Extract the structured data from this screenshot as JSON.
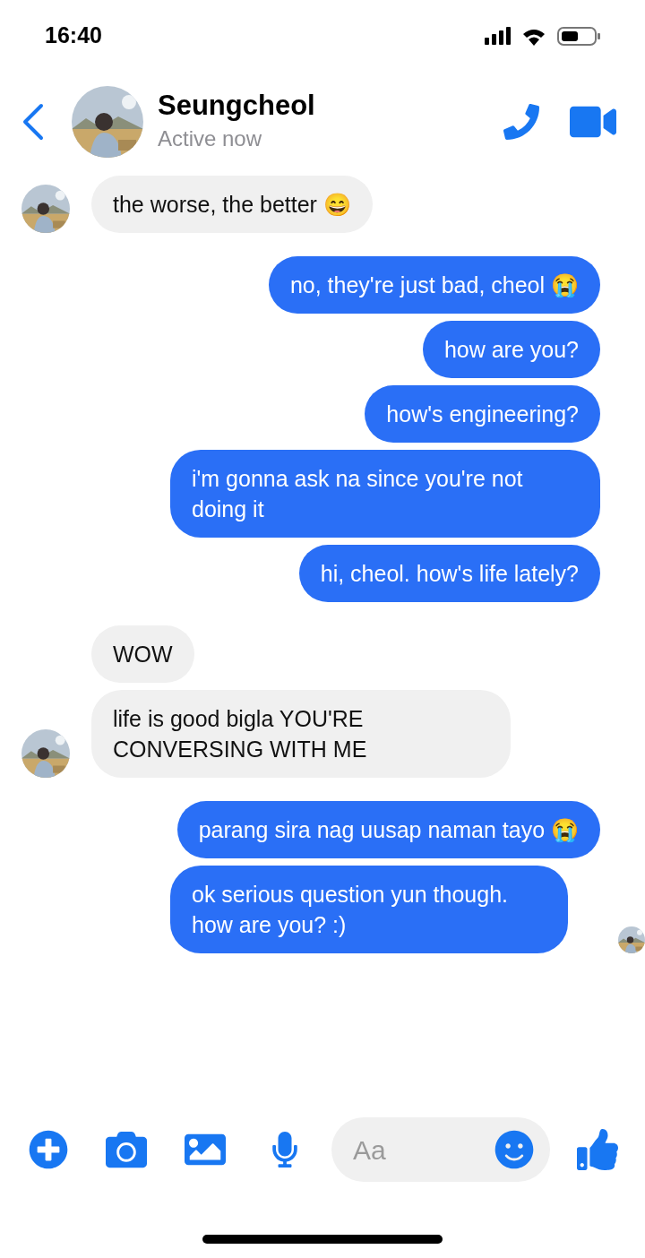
{
  "status_bar": {
    "time": "16:40"
  },
  "header": {
    "name": "Seungcheol",
    "status": "Active now"
  },
  "groups": [
    {
      "kind": "incoming",
      "messages": [
        {
          "text": "the worse, the better 😄",
          "seen": false
        }
      ]
    },
    {
      "kind": "outgoing",
      "messages": [
        {
          "text": "no, they're just bad, cheol 😭",
          "seen": false
        },
        {
          "text": "how are you?",
          "seen": false
        },
        {
          "text": "how's engineering?",
          "seen": false
        },
        {
          "text": "i'm gonna ask na since you're not doing it",
          "seen": false
        },
        {
          "text": "hi, cheol. how's life lately?",
          "seen": false
        }
      ]
    },
    {
      "kind": "incoming",
      "messages": [
        {
          "text": "WOW",
          "seen": false
        },
        {
          "text": "life is good bigla YOU'RE CONVERSING WITH ME",
          "seen": false
        }
      ]
    },
    {
      "kind": "outgoing",
      "messages": [
        {
          "text": "parang sira nag uusap naman tayo 😭",
          "seen": false
        },
        {
          "text": "ok serious question yun though. how are you? :)",
          "seen": true
        }
      ]
    }
  ],
  "composer": {
    "placeholder": "Aa"
  }
}
